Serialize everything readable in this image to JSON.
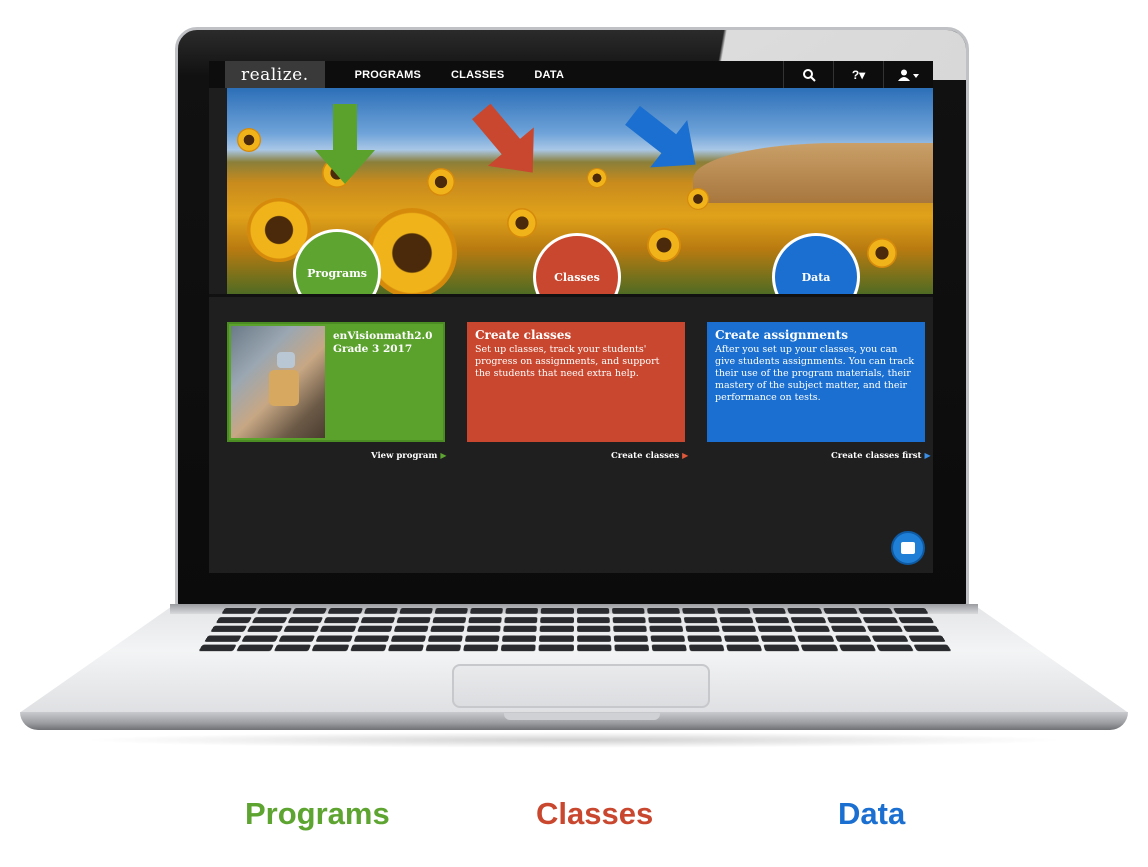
{
  "nav": {
    "brand": "realize.",
    "links": [
      "PROGRAMS",
      "CLASSES",
      "DATA"
    ],
    "search_icon": "search-icon",
    "help_label": "?▾",
    "user_icon": "user-icon"
  },
  "hero": {
    "circles": {
      "programs": "Programs",
      "classes": "Classes",
      "data": "Data"
    },
    "arrow_colors": {
      "programs": "#5aa22c",
      "classes": "#c9472e",
      "data": "#1a6fd0"
    }
  },
  "cards": {
    "program": {
      "title_line1": "enVisionmath2.0",
      "title_line2": "Grade 3 2017",
      "link": "View program"
    },
    "classes": {
      "title": "Create classes",
      "text": "Set up classes, track your students' progress on assignments, and support the students that need extra help.",
      "link": "Create classes"
    },
    "assignments": {
      "title": "Create assignments",
      "text": "After you set up your classes, you can give students assignments. You can track their use of the program materials, their mastery of the subject matter, and their performance on tests.",
      "link": "Create classes first"
    }
  },
  "captions": {
    "programs": "Programs",
    "classes": "Classes",
    "data": "Data"
  },
  "colors": {
    "programs": "#5da431",
    "classes": "#c9472e",
    "data": "#1a6fd0"
  }
}
